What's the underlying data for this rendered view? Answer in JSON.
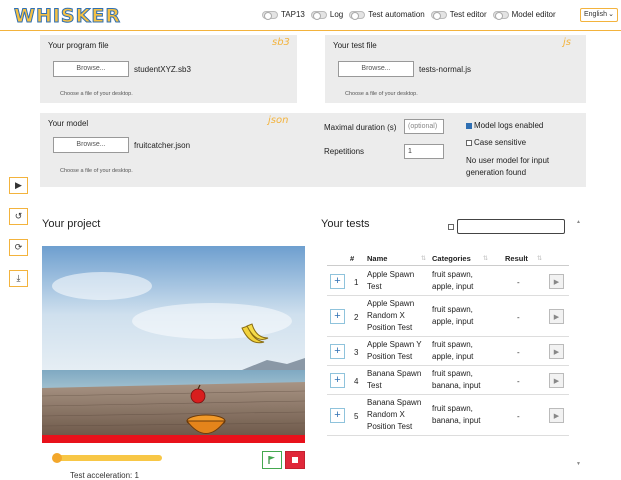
{
  "header": {
    "logo": "WHISKER",
    "toggles": [
      "TAP13",
      "Log",
      "Test automation",
      "Test editor",
      "Model editor"
    ],
    "language": "English"
  },
  "program_file": {
    "title": "Your program file",
    "ext": "sb3",
    "browse": "Browse...",
    "file": "studentXYZ.sb3",
    "hint": "Choose a file of your desktop."
  },
  "test_file": {
    "title": "Your test file",
    "ext": "js",
    "browse": "Browse...",
    "file": "tests-normal.js",
    "hint": "Choose a file of your desktop."
  },
  "model": {
    "title": "Your model",
    "ext": "json",
    "browse": "Browse...",
    "file": "fruitcatcher.json",
    "hint": "Choose a file of your desktop.",
    "max_duration_label": "Maximal duration (s)",
    "max_duration_placeholder": "(optional)",
    "repetitions_label": "Repetitions",
    "repetitions_value": "1",
    "model_logs_label": "Model logs enabled",
    "model_logs_checked": true,
    "case_sensitive_label": "Case sensitive",
    "case_sensitive_checked": false,
    "no_model_note": "No user model for input generation found"
  },
  "project": {
    "title": "Your project",
    "progress": 0.02,
    "acceleration": "Test acceleration: 1"
  },
  "tests": {
    "title": "Your tests",
    "headers": {
      "num": "#",
      "name": "Name",
      "categories": "Categories",
      "result": "Result"
    },
    "rows": [
      {
        "num": "1",
        "name": "Apple Spawn Test",
        "categories": "fruit spawn, apple, input",
        "result": "-"
      },
      {
        "num": "2",
        "name": "Apple Spawn Random X Position Test",
        "categories": "fruit spawn, apple, input",
        "result": "-"
      },
      {
        "num": "3",
        "name": "Apple Spawn Y Position Test",
        "categories": "fruit spawn, apple, input",
        "result": "-"
      },
      {
        "num": "4",
        "name": "Banana Spawn Test",
        "categories": "fruit spawn, banana, input",
        "result": "-"
      },
      {
        "num": "5",
        "name": "Banana Spawn Random X Position Test",
        "categories": "fruit spawn, banana, input",
        "result": "-"
      }
    ]
  },
  "colors": {
    "accent": "#f3b33d",
    "logo_fill": "#f5c144",
    "logo_stroke": "#2f6fb3",
    "stage_bar": "#e8111b",
    "stop": "#e0283a",
    "flag": "#44a84f"
  },
  "icons": {
    "tools": [
      "play-icon",
      "reset-icon",
      "reload-icon",
      "download-icon"
    ]
  }
}
